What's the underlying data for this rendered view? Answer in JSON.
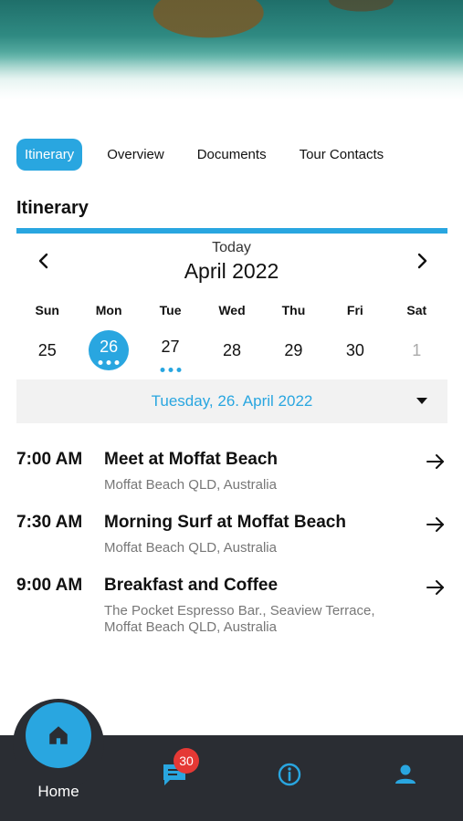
{
  "tabs": [
    {
      "label": "Itinerary",
      "active": true
    },
    {
      "label": "Overview",
      "active": false
    },
    {
      "label": "Documents",
      "active": false
    },
    {
      "label": "Tour Contacts",
      "active": false
    }
  ],
  "section_title": "Itinerary",
  "calendar": {
    "today_label": "Today",
    "month_label": "April 2022",
    "weekdays": [
      "Sun",
      "Mon",
      "Tue",
      "Wed",
      "Thu",
      "Fri",
      "Sat"
    ],
    "days": [
      {
        "num": "25",
        "state": "normal",
        "dots": 0
      },
      {
        "num": "26",
        "state": "selected",
        "dots": 3
      },
      {
        "num": "27",
        "state": "normal",
        "dots": 3
      },
      {
        "num": "28",
        "state": "normal",
        "dots": 0
      },
      {
        "num": "29",
        "state": "normal",
        "dots": 0
      },
      {
        "num": "30",
        "state": "normal",
        "dots": 0
      },
      {
        "num": "1",
        "state": "muted",
        "dots": 0
      }
    ],
    "selected_date_label": "Tuesday, 26. April 2022"
  },
  "events": [
    {
      "time": "7:00 AM",
      "title": "Meet at Moffat Beach",
      "location": "Moffat Beach QLD, Australia"
    },
    {
      "time": "7:30 AM",
      "title": "Morning Surf at Moffat Beach",
      "location": "Moffat Beach QLD, Australia"
    },
    {
      "time": "9:00 AM",
      "title": "Breakfast and Coffee",
      "location": "The Pocket Espresso Bar., Seaview Terrace, Moffat Beach QLD, Australia"
    }
  ],
  "bottom_nav": {
    "home_label": "Home",
    "messages_badge": "30"
  },
  "colors": {
    "accent": "#29a6e0",
    "tabbar": "#2a2d33",
    "badge": "#e53935"
  }
}
